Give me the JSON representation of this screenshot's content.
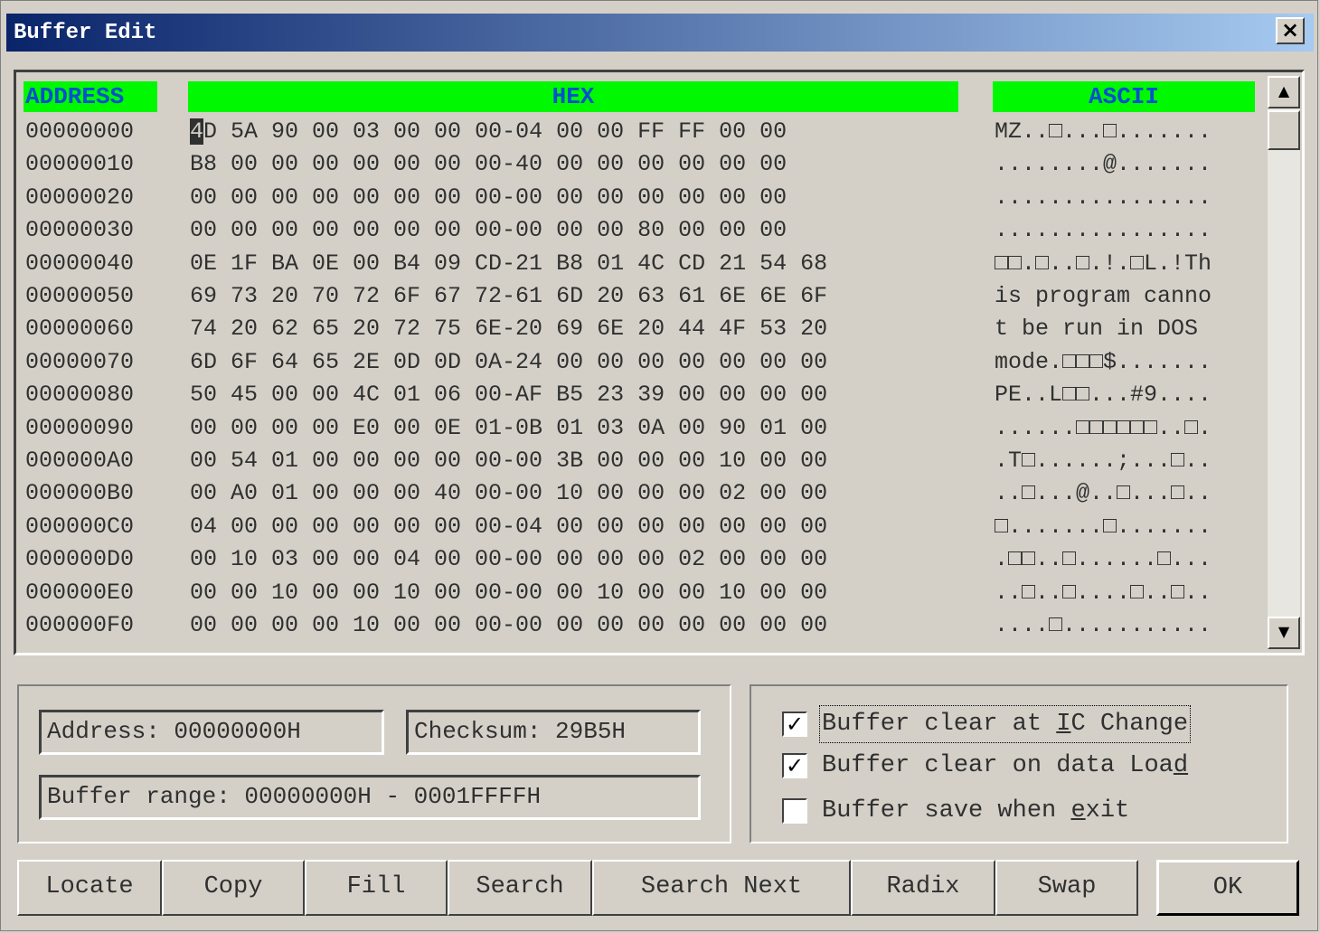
{
  "window": {
    "title": "Buffer Edit",
    "close_glyph": "×"
  },
  "headers": {
    "address": "ADDRESS",
    "hex": "HEX",
    "ascii": "ASCII"
  },
  "rows": [
    {
      "address": "00000000",
      "hex_first": "4",
      "hex": "D 5A 90 00 03 00 00 00-04 00 00 FF FF 00 00",
      "ascii": "MZ..□...□......."
    },
    {
      "address": "00000010",
      "hex_first": "",
      "hex": "B8 00 00 00 00 00 00 00-40 00 00 00 00 00 00",
      "ascii": "........@......."
    },
    {
      "address": "00000020",
      "hex_first": "",
      "hex": "00 00 00 00 00 00 00 00-00 00 00 00 00 00 00",
      "ascii": "................"
    },
    {
      "address": "00000030",
      "hex_first": "",
      "hex": "00 00 00 00 00 00 00 00-00 00 00 80 00 00 00",
      "ascii": "................"
    },
    {
      "address": "00000040",
      "hex_first": "",
      "hex": "0E 1F BA 0E 00 B4 09 CD-21 B8 01 4C CD 21 54 68",
      "ascii": "□□.□..□.!.□L.!Th"
    },
    {
      "address": "00000050",
      "hex_first": "",
      "hex": "69 73 20 70 72 6F 67 72-61 6D 20 63 61 6E 6E 6F",
      "ascii": "is program canno"
    },
    {
      "address": "00000060",
      "hex_first": "",
      "hex": "74 20 62 65 20 72 75 6E-20 69 6E 20 44 4F 53 20",
      "ascii": "t be run in DOS "
    },
    {
      "address": "00000070",
      "hex_first": "",
      "hex": "6D 6F 64 65 2E 0D 0D 0A-24 00 00 00 00 00 00 00",
      "ascii": "mode.□□□$......."
    },
    {
      "address": "00000080",
      "hex_first": "",
      "hex": "50 45 00 00 4C 01 06 00-AF B5 23 39 00 00 00 00",
      "ascii": "PE..L□□...#9...."
    },
    {
      "address": "00000090",
      "hex_first": "",
      "hex": "00 00 00 00 E0 00 0E 01-0B 01 03 0A 00 90 01 00",
      "ascii": "......□□□□□□..□."
    },
    {
      "address": "000000A0",
      "hex_first": "",
      "hex": "00 54 01 00 00 00 00 00-00 3B 00 00 00 10 00 00",
      "ascii": ".T□......;...□.."
    },
    {
      "address": "000000B0",
      "hex_first": "",
      "hex": "00 A0 01 00 00 00 40 00-00 10 00 00 00 02 00 00",
      "ascii": "..□...@..□...□.."
    },
    {
      "address": "000000C0",
      "hex_first": "",
      "hex": "04 00 00 00 00 00 00 00-04 00 00 00 00 00 00 00",
      "ascii": "□.......□......."
    },
    {
      "address": "000000D0",
      "hex_first": "",
      "hex": "00 10 03 00 00 04 00 00-00 00 00 00 02 00 00 00",
      "ascii": ".□□..□......□..."
    },
    {
      "address": "000000E0",
      "hex_first": "",
      "hex": "00 00 10 00 00 10 00 00-00 00 10 00 00 10 00 00",
      "ascii": "..□..□....□..□.."
    },
    {
      "address": "000000F0",
      "hex_first": "",
      "hex": "00 00 00 00 10 00 00 00-00 00 00 00 00 00 00 00",
      "ascii": "....□..........."
    }
  ],
  "info": {
    "address": "Address: 00000000H",
    "checksum": "Checksum: 29B5H",
    "range": "Buffer range: 00000000H - 0001FFFFH"
  },
  "options": [
    {
      "pre": "Buffer clear at ",
      "key": "I",
      "post": "C Change",
      "checked": true,
      "mark": "✓"
    },
    {
      "pre": "Buffer clear on data Loa",
      "key": "d",
      "post": "",
      "checked": true,
      "mark": "✓"
    },
    {
      "pre": "Buffer save when ",
      "key": "e",
      "post": "xit",
      "checked": false,
      "mark": ""
    }
  ],
  "buttons": {
    "locate": "Locate",
    "copy": "Copy",
    "fill": "Fill",
    "search": "Search",
    "search_next": "Search Next",
    "radix": "Radix",
    "swap": "Swap",
    "ok": "OK"
  },
  "scroll": {
    "up": "▲",
    "down": "▼"
  }
}
